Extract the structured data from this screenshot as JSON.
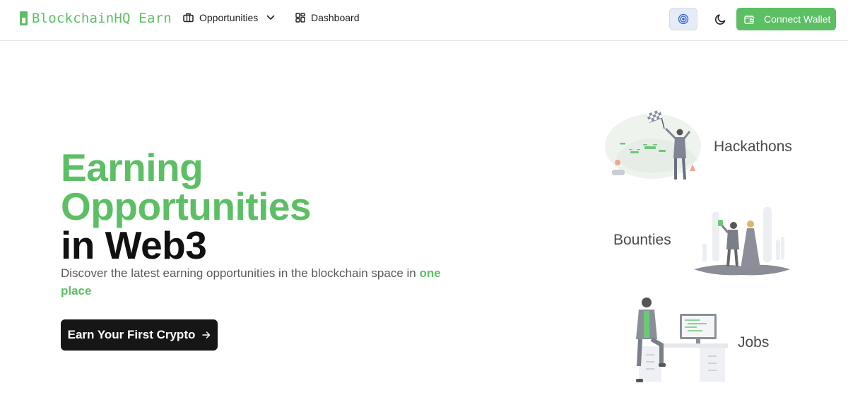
{
  "header": {
    "logo_text": "BlockchainHQ Earn",
    "nav": {
      "opportunities_label": "Opportunities",
      "dashboard_label": "Dashboard"
    },
    "connect_wallet_label": "Connect Wallet",
    "icons": {
      "opportunities": "briefcase-icon",
      "dropdown": "chevron-down-icon",
      "dashboard": "grid-icon",
      "network": "target-icon",
      "theme": "moon-icon",
      "wallet": "wallet-icon"
    }
  },
  "hero": {
    "title_line1": "Earning",
    "title_line2": "Opportunities",
    "title_line3": "in Web3",
    "subtitle_text": "Discover the latest earning opportunities in the blockchain space in ",
    "subtitle_highlight": "one place",
    "cta_label": "Earn Your First Crypto",
    "cta_icon": "arrow-right-icon"
  },
  "categories": [
    {
      "label": "Hackathons"
    },
    {
      "label": "Bounties"
    },
    {
      "label": "Jobs"
    }
  ],
  "colors": {
    "accent": "#5cbf64",
    "dark": "#161616",
    "text_muted": "#5a5a5a"
  }
}
